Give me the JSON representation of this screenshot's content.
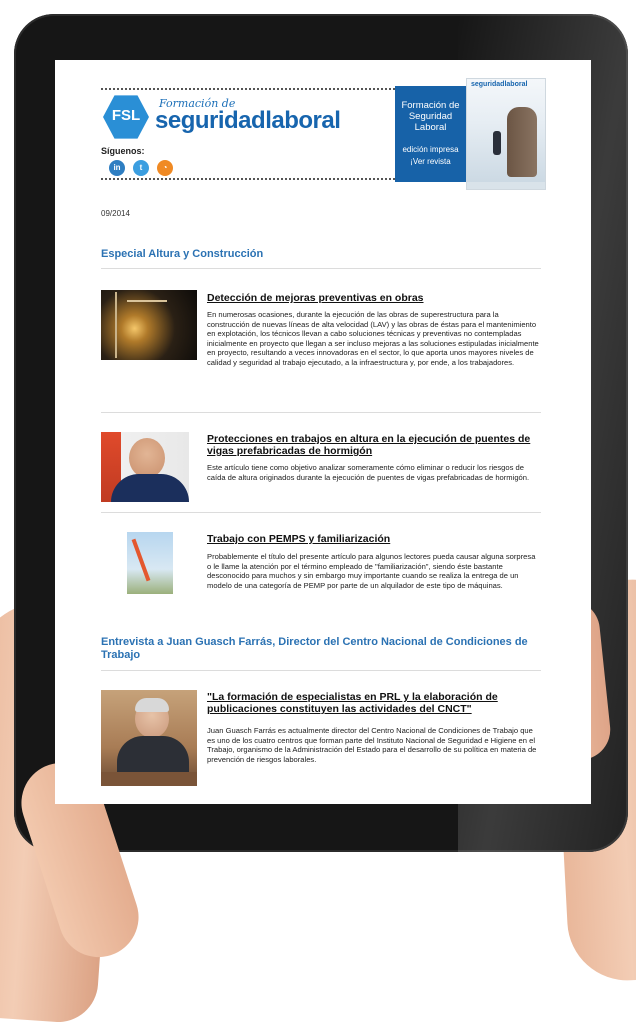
{
  "header": {
    "logo_badge": "FSL",
    "logo_top": "Formación de",
    "logo_main": "seguridadlaboral",
    "follow_label": "Síguenos:",
    "social": {
      "linkedin": "in",
      "twitter": "t",
      "rss": "◔"
    }
  },
  "promo": {
    "title": "Formación de Seguridad Laboral",
    "subtitle": "edición impresa",
    "link": "¡Ver revista",
    "magazine_title": "seguridadlaboral"
  },
  "date": "09/2014",
  "sections": [
    {
      "title": "Especial Altura y Construcción",
      "articles": [
        {
          "title": "Detección de mejoras preventivas en obras",
          "body": "En numerosas ocasiones, durante la ejecución de las obras de superestructura para la construcción de nuevas líneas de alta velocidad (LAV) y las obras de éstas para el mantenimiento en explotación, los técnicos llevan a cabo soluciones técnicas y preventivas no contempladas inicialmente en proyecto que llegan a ser incluso mejoras a las soluciones estipuladas inicialmente en proyecto, resultando a veces innovadoras en el sector, lo que aporta unos mayores niveles de calidad y seguridad al trabajo ejecutado, a la infraestructura y, por ende, a los trabajadores."
        },
        {
          "title": "Protecciones en trabajos en altura en la ejecución de puentes de vigas prefabricadas de hormigón",
          "body": "Este artículo tiene como objetivo analizar someramente cómo eliminar o reducir los riesgos de caída de altura originados durante la ejecución de puentes de vigas prefabricadas de hormigón."
        },
        {
          "title": "Trabajo con PEMPS y familiarización",
          "body": "Probablemente el título del presente artículo para algunos lectores pueda causar alguna sorpresa o le llame la atención por el término empleado de \"familiarización\", siendo éste bastante desconocido para muchos y sin embargo muy importante cuando se realiza la entrega de un modelo de una categoría de PEMP por parte de un alquilador de este tipo de máquinas."
        }
      ]
    },
    {
      "title": "Entrevista a Juan Guasch Farrás, Director del Centro Nacional de Condiciones de Trabajo",
      "articles": [
        {
          "title": "\"La formación de especialistas en PRL y la elaboración de publicaciones constituyen las actividades del CNCT\"",
          "body": "Juan Guasch Farrás es actualmente director del Centro Nacional de Condiciones de Trabajo que es uno de los cuatro centros que forman parte del Instituto Nacional de Seguridad e Higiene en el Trabajo, organismo de la Administración del Estado para el desarrollo de su política en materia de prevención de riesgos laborales."
        }
      ]
    }
  ]
}
